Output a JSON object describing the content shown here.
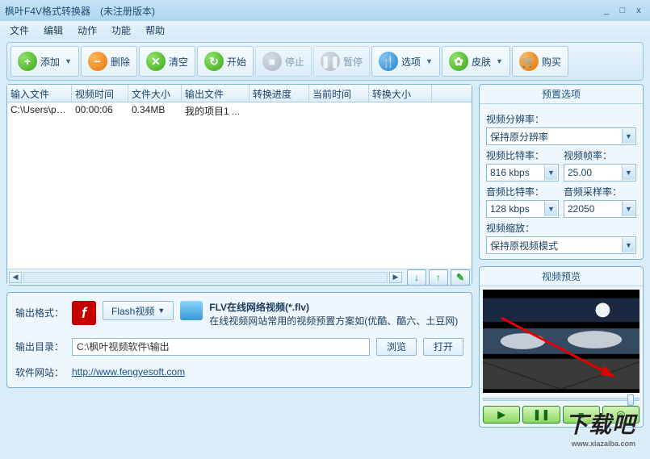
{
  "title": {
    "app": "枫叶F4V格式转换器",
    "status": "(未注册版本)"
  },
  "win": {
    "min": "_",
    "max": "□",
    "close": "x"
  },
  "menu": [
    "文件",
    "编辑",
    "动作",
    "功能",
    "帮助"
  ],
  "toolbar": [
    {
      "label": "添加",
      "icon": "+",
      "cls": "i-green",
      "dd": true,
      "name": "add-button"
    },
    {
      "label": "删除",
      "icon": "−",
      "cls": "i-orange",
      "name": "delete-button"
    },
    {
      "label": "清空",
      "icon": "✕",
      "cls": "i-green",
      "name": "clear-button"
    },
    {
      "label": "开始",
      "icon": "↻",
      "cls": "i-green",
      "name": "start-button"
    },
    {
      "label": "停止",
      "icon": "■",
      "cls": "i-gray",
      "disabled": true,
      "name": "stop-button"
    },
    {
      "label": "暂停",
      "icon": "❚❚",
      "cls": "i-gray",
      "disabled": true,
      "name": "pause-button"
    },
    {
      "label": "选项",
      "icon": "🍴",
      "cls": "i-blue",
      "dd": true,
      "name": "options-button"
    },
    {
      "label": "皮肤",
      "icon": "✿",
      "cls": "i-green",
      "dd": true,
      "name": "skin-button"
    },
    {
      "label": "购买",
      "icon": "🛒",
      "cls": "i-orange",
      "name": "buy-button"
    }
  ],
  "grid": {
    "headers": [
      "输入文件",
      "视频时间",
      "文件大小",
      "输出文件",
      "转换进度",
      "当前时间",
      "转换大小"
    ],
    "rows": [
      {
        "c1": "C:\\Users\\pc\\...",
        "c2": "00:00:06",
        "c3": "0.34MB",
        "c4": "我的项目1 ...",
        "c5": "",
        "c6": "",
        "c7": ""
      }
    ]
  },
  "preset": {
    "title": "预置选项",
    "res_label": "视频分辨率：",
    "res_val": "保持原分辨率",
    "vbr_label": "视频比特率：",
    "vbr_val": "816 kbps",
    "fps_label": "视频帧率：",
    "fps_val": "25.00",
    "abr_label": "音频比特率：",
    "abr_val": "128 kbps",
    "asr_label": "音频采样率：",
    "asr_val": "22050",
    "scale_label": "视频缩放：",
    "scale_val": "保持原视频模式"
  },
  "output": {
    "fmt_label": "输出格式：",
    "fmt_btn": "Flash视频",
    "fmt_title": "FLV在线网络视频(*.flv)",
    "fmt_desc": "在线视频网站常用的视频预置方案如(优酷、酷六、土豆网)",
    "dir_label": "输出目录：",
    "dir_val": "C:\\枫叶视频软件\\输出",
    "browse": "浏览",
    "open": "打开",
    "site_label": "软件网站：",
    "site_url": "http://www.fengyesoft.com"
  },
  "preview": {
    "title": "视频预览"
  },
  "watermark": {
    "main": "下载吧",
    "sub": "www.xiazaiba.com"
  }
}
